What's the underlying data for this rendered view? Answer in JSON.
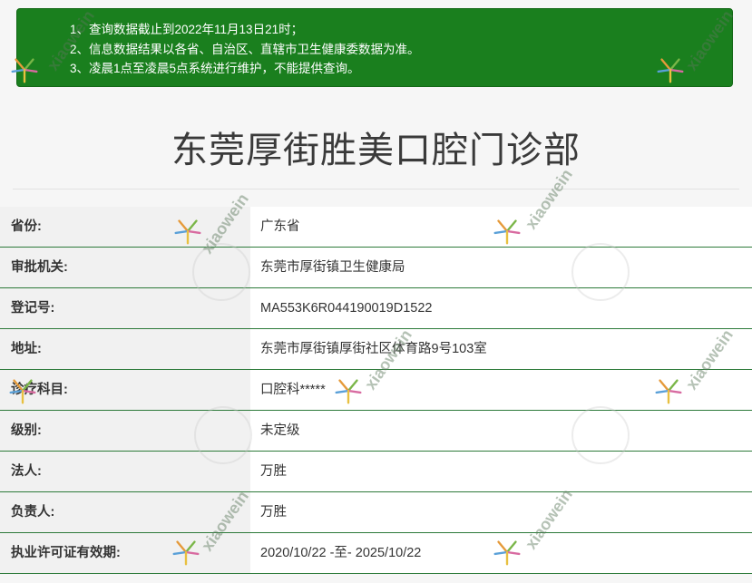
{
  "notice": {
    "lines": [
      "1、查询数据截止到2022年11月13日21时；",
      "2、信息数据结果以各省、自治区、直辖市卫生健康委数据为准。",
      "3、凌晨1点至凌晨5点系统进行维护，不能提供查询。"
    ]
  },
  "clinic": {
    "name": "东莞厚街胜美口腔门诊部"
  },
  "rows": [
    {
      "label": "省份:",
      "value": "广东省"
    },
    {
      "label": "审批机关:",
      "value": "东莞市厚街镇卫生健康局"
    },
    {
      "label": "登记号:",
      "value": "MA553K6R044190019D1522"
    },
    {
      "label": "地址:",
      "value": "东莞市厚街镇厚街社区体育路9号103室"
    },
    {
      "label": "诊疗科目:",
      "value": "口腔科*****"
    },
    {
      "label": "级别:",
      "value": "未定级"
    },
    {
      "label": "法人:",
      "value": "万胜"
    },
    {
      "label": "负责人:",
      "value": "万胜"
    },
    {
      "label": "执业许可证有效期:",
      "value": "2020/10/22 -至- 2025/10/22"
    }
  ],
  "watermark": {
    "text": "xiaowein"
  },
  "colors": {
    "notice_bg": "#1a7f1e",
    "row_border": "#2d7a3a",
    "label_bg": "#f1f1f1"
  }
}
